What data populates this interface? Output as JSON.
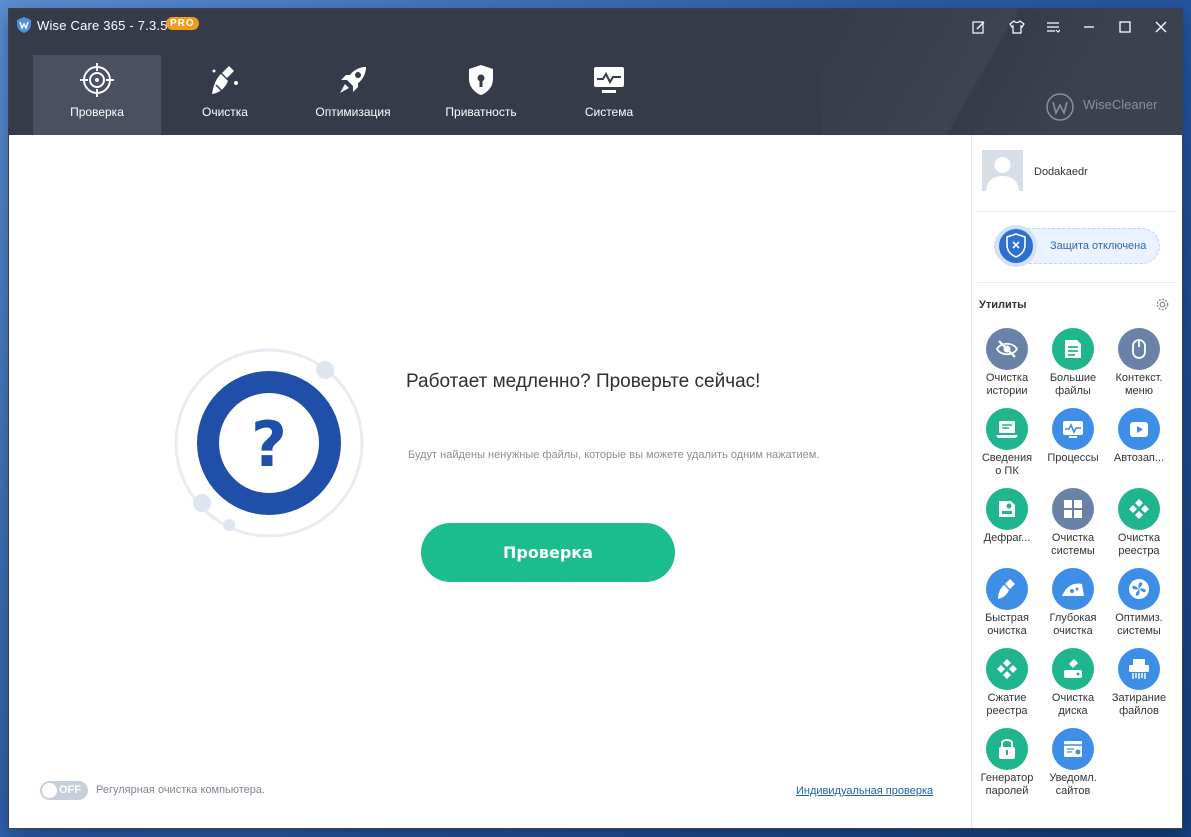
{
  "window": {
    "title": "Wise Care 365 - 7.3.5",
    "badge": "PRO"
  },
  "nav": {
    "tabs": [
      {
        "label": "Проверка",
        "icon": "target-icon",
        "active": true
      },
      {
        "label": "Очистка",
        "icon": "broom-icon",
        "active": false
      },
      {
        "label": "Оптимизация",
        "icon": "rocket-icon",
        "active": false
      },
      {
        "label": "Приватность",
        "icon": "shield-lock-icon",
        "active": false
      },
      {
        "label": "Система",
        "icon": "monitor-icon",
        "active": false
      }
    ],
    "brand": "WiseCleaner"
  },
  "main": {
    "heading": "Работает медленно? Проверьте сейчас!",
    "subtext": "Будут найдены ненужные файлы, которые вы можете удалить одним нажатием.",
    "scan_button": "Проверка",
    "gauge_symbol": "?",
    "toggle_label": "OFF",
    "schedule_text": "Регулярная очистка компьютера.",
    "custom_link": "Индивидуальная проверка"
  },
  "sidebar": {
    "username": "Dodakaedr",
    "protection_text": "Защита отключена",
    "utilities_title": "Утилиты",
    "utilities": [
      {
        "label": "Очистка\nистории",
        "icon": "eye-off-icon",
        "color": "#6b82a8"
      },
      {
        "label": "Большие\nфайлы",
        "icon": "file-list-icon",
        "color": "#1fb58f"
      },
      {
        "label": "Контекст.\nменю",
        "icon": "mouse-icon",
        "color": "#6b82a8"
      },
      {
        "label": "Сведения\nо ПК",
        "icon": "laptop-icon",
        "color": "#1fb58f"
      },
      {
        "label": "Процессы",
        "icon": "activity-icon",
        "color": "#3d8ee6"
      },
      {
        "label": "Автозап...",
        "icon": "play-icon",
        "color": "#3d8ee6"
      },
      {
        "label": "Дефраг...",
        "icon": "defrag-icon",
        "color": "#1fb58f"
      },
      {
        "label": "Очистка\nсистемы",
        "icon": "windows-icon",
        "color": "#6b82a8"
      },
      {
        "label": "Очистка\nреестра",
        "icon": "registry-icon",
        "color": "#1fb58f"
      },
      {
        "label": "Быстрая\nочистка",
        "icon": "brush-icon",
        "color": "#3d8ee6"
      },
      {
        "label": "Глубокая\nочистка",
        "icon": "deep-clean-icon",
        "color": "#3d8ee6"
      },
      {
        "label": "Оптимиз.\nсистемы",
        "icon": "fan-icon",
        "color": "#3d8ee6"
      },
      {
        "label": "Сжатие\nреестра",
        "icon": "registry-compress-icon",
        "color": "#1fb58f"
      },
      {
        "label": "Очистка\nдиска",
        "icon": "disk-clean-icon",
        "color": "#1fb58f"
      },
      {
        "label": "Затирание\nфайлов",
        "icon": "shredder-icon",
        "color": "#3d8ee6"
      },
      {
        "label": "Генератор\nпаролей",
        "icon": "lock-icon",
        "color": "#1fb58f"
      },
      {
        "label": "Уведомл.\nсайтов",
        "icon": "notification-icon",
        "color": "#3d8ee6"
      }
    ]
  },
  "colors": {
    "header": "#363b4a",
    "accent_green": "#1bbc8e",
    "gauge_blue": "#1f4fa8",
    "link_blue": "#1c63b8"
  }
}
